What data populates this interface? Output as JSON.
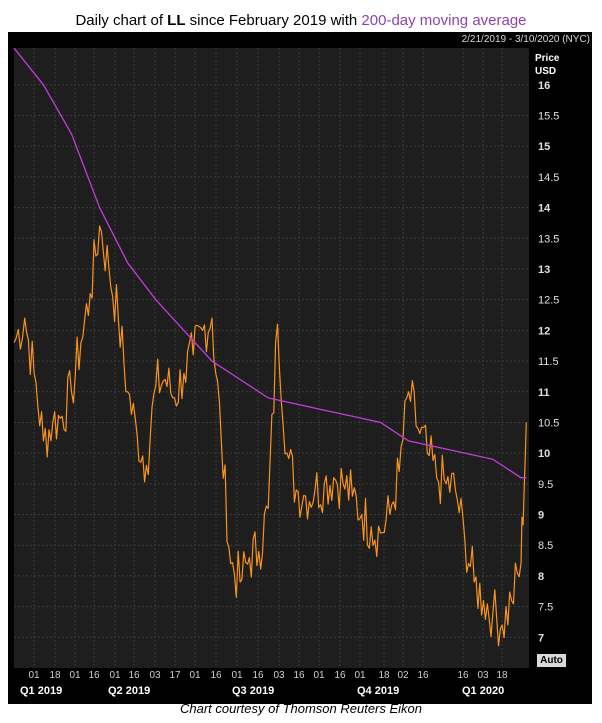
{
  "title": {
    "prefix": "Daily chart of ",
    "ticker": "LL",
    "middle": " since February 2019 with ",
    "ma_label": "200-day moving average"
  },
  "date_range": "2/21/2019 - 3/10/2020 (NYC)",
  "axis_controls": {
    "auto_label": "Auto"
  },
  "footer": "Chart courtesy of Thomson Reuters Eikon",
  "colors": {
    "price": "#f7931e",
    "ma": "#c23ddb",
    "background": "#1e1e1e",
    "grid": "#3a3a3a"
  },
  "chart_data": {
    "type": "line",
    "title": "Daily chart of LL since February 2019 with 200-day moving average",
    "ylabel": "Price USD",
    "ylim": [
      6.5,
      16.6
    ],
    "y_ticks": [
      7,
      7.5,
      8,
      8.5,
      9,
      9.5,
      10,
      10.5,
      11,
      11.5,
      12,
      12.5,
      13,
      13.5,
      14,
      14.5,
      15,
      15.5,
      16
    ],
    "x_day_ticks": [
      "01",
      "18",
      "01",
      "16",
      "01",
      "16",
      "03",
      "17",
      "01",
      "16",
      "01",
      "16",
      "03",
      "16",
      "01",
      "16",
      "01",
      "18",
      "02",
      "16",
      "16",
      "03",
      "18"
    ],
    "x_quarters": [
      "Q1 2019",
      "Q2 2019",
      "Q3 2019",
      "Q4 2019",
      "Q1 2020"
    ],
    "grid": true,
    "legend": "none",
    "series": [
      {
        "name": "LL",
        "x": [
          "2019-02-21",
          "2019-03-01",
          "2019-03-08",
          "2019-03-15",
          "2019-03-22",
          "2019-03-29",
          "2019-04-05",
          "2019-04-12",
          "2019-04-19",
          "2019-04-26",
          "2019-05-03",
          "2019-05-10",
          "2019-05-17",
          "2019-05-24",
          "2019-05-31",
          "2019-06-07",
          "2019-06-14",
          "2019-06-21",
          "2019-06-28",
          "2019-07-05",
          "2019-07-12",
          "2019-07-19",
          "2019-07-26",
          "2019-08-02",
          "2019-08-09",
          "2019-08-16",
          "2019-08-23",
          "2019-08-30",
          "2019-09-06",
          "2019-09-13",
          "2019-09-20",
          "2019-09-27",
          "2019-10-04",
          "2019-10-11",
          "2019-10-18",
          "2019-10-25",
          "2019-11-01",
          "2019-11-08",
          "2019-11-15",
          "2019-11-22",
          "2019-11-29",
          "2019-12-06",
          "2019-12-13",
          "2019-12-20",
          "2019-12-27",
          "2020-01-03",
          "2020-01-10",
          "2020-01-17",
          "2020-01-24",
          "2020-01-31",
          "2020-02-07",
          "2020-02-14",
          "2020-02-21",
          "2020-02-28",
          "2020-03-06",
          "2020-03-10"
        ],
        "values": [
          11.8,
          12.2,
          11.3,
          10.2,
          10.5,
          10.6,
          11.0,
          11.8,
          12.6,
          13.7,
          13.0,
          12.2,
          11.0,
          10.3,
          9.8,
          11.1,
          11.2,
          10.9,
          11.3,
          11.6,
          12.0,
          12.2,
          10.2,
          8.2,
          7.9,
          8.3,
          8.4,
          9.1,
          12.1,
          10.0,
          9.4,
          9.3,
          9.4,
          9.5,
          9.6,
          9.5,
          9.3,
          9.0,
          8.8,
          8.7,
          9.0,
          9.7,
          11.0,
          10.4,
          10.0,
          9.6,
          9.5,
          9.4,
          8.6,
          7.9,
          7.6,
          7.4,
          7.2,
          7.6,
          8.2,
          10.5
        ]
      },
      {
        "name": "200-day moving average",
        "x": [
          "2019-02-21",
          "2019-03-15",
          "2019-04-05",
          "2019-04-26",
          "2019-05-17",
          "2019-06-07",
          "2019-06-28",
          "2019-07-19",
          "2019-08-09",
          "2019-08-30",
          "2019-09-20",
          "2019-10-11",
          "2019-11-01",
          "2019-11-22",
          "2019-12-13",
          "2020-01-03",
          "2020-01-24",
          "2020-02-14",
          "2020-03-06",
          "2020-03-10"
        ],
        "values": [
          16.6,
          16.0,
          15.2,
          14.0,
          13.1,
          12.5,
          12.0,
          11.5,
          11.2,
          10.9,
          10.8,
          10.7,
          10.6,
          10.5,
          10.2,
          10.1,
          10.0,
          9.9,
          9.6,
          9.6
        ]
      }
    ]
  }
}
